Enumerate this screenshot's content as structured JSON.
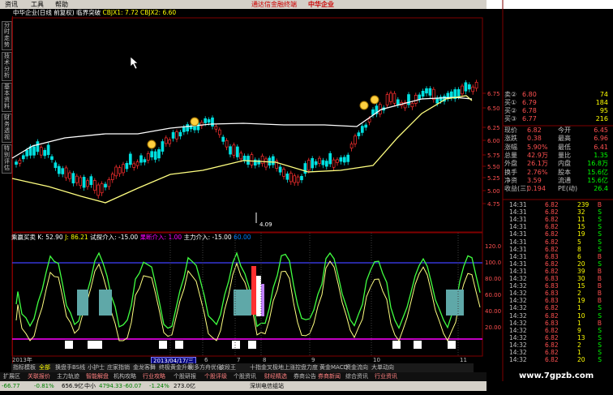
{
  "menu": {
    "items": [
      "资讯",
      "工具",
      "帮助"
    ],
    "brand": "通达信金融终端",
    "stock_name": "中华企业"
  },
  "left_tabs": [
    "分时走势",
    "技术分析",
    "基本资料",
    "财务透视",
    "特别评估"
  ],
  "chart": {
    "title_prefix": "中华企业(日线 前复权)",
    "title_indicator": "临界突破",
    "cbjx1": "CBJX1: 7.72",
    "cbjx2": "CBJX2: 6.60",
    "price_axis": [
      "6.75",
      "6.50",
      "6.25",
      "6.00",
      "5.75",
      "5.50",
      "5.25",
      "5.00",
      "4.75"
    ],
    "low_label": "4.09"
  },
  "indicator": {
    "name": "乘赢买卖",
    "k": "K: 52.90",
    "j": "J: 86.21",
    "trial": "试探介入: -15.00",
    "decisive": "果断介入: 1.00",
    "main": "主力介入: -15.00",
    "last_value": "60.00",
    "axis": [
      "120.0",
      "100.0",
      "80.00",
      "60.00",
      "40.00",
      "20.00"
    ]
  },
  "quote": [
    {
      "label": "卖②",
      "val": "6.80",
      "right": "74"
    },
    {
      "label": "买①",
      "val": "6.79",
      "right": "184"
    },
    {
      "label": "买②",
      "val": "6.78",
      "right": "95"
    },
    {
      "label": "买③",
      "val": "6.77",
      "right": "216"
    }
  ],
  "stats": [
    {
      "l1": "现价",
      "v1": "6.82",
      "l2": "今开",
      "v2": "6.45"
    },
    {
      "l1": "涨跌",
      "v1": "0.38",
      "l2": "最高",
      "v2": "6.96"
    },
    {
      "l1": "涨幅",
      "v1": "5.90%",
      "l2": "最低",
      "v2": "6.41"
    },
    {
      "l1": "总量",
      "v1": "42.9万",
      "l2": "量比",
      "v2": "1.35"
    },
    {
      "l1": "外盘",
      "v1": "26.1万",
      "l2": "内盘",
      "v2": "16.8万"
    },
    {
      "l1": "换手",
      "v1": "2.76%",
      "l2": "股本",
      "v2": "15.6亿"
    },
    {
      "l1": "净资",
      "v1": "3.59",
      "l2": "流通",
      "v2": "15.6亿"
    },
    {
      "l1": "收益(三)",
      "v1": "0.194",
      "l2": "PE(动)",
      "v2": "26.4"
    }
  ],
  "trades": [
    {
      "time": "14:31",
      "price": "6.82",
      "vol": "239",
      "bs": "B"
    },
    {
      "time": "14:31",
      "price": "6.82",
      "vol": "32",
      "bs": "S"
    },
    {
      "time": "14:31",
      "price": "6.82",
      "vol": "11",
      "bs": "S"
    },
    {
      "time": "14:31",
      "price": "6.82",
      "vol": "15",
      "bs": "S"
    },
    {
      "time": "14:31",
      "price": "6.82",
      "vol": "19",
      "bs": "S"
    },
    {
      "time": "14:31",
      "price": "6.82",
      "vol": "5",
      "bs": "S"
    },
    {
      "time": "14:31",
      "price": "6.82",
      "vol": "8",
      "bs": "S"
    },
    {
      "time": "14:31",
      "price": "6.83",
      "vol": "6",
      "bs": "B"
    },
    {
      "time": "14:31",
      "price": "6.82",
      "vol": "20",
      "bs": "S"
    },
    {
      "time": "14:31",
      "price": "6.82",
      "vol": "39",
      "bs": "B"
    },
    {
      "time": "14:32",
      "price": "6.83",
      "vol": "30",
      "bs": "B"
    },
    {
      "time": "14:32",
      "price": "6.83",
      "vol": "15",
      "bs": "B"
    },
    {
      "time": "14:32",
      "price": "6.83",
      "vol": "2",
      "bs": "B"
    },
    {
      "time": "14:32",
      "price": "6.83",
      "vol": "19",
      "bs": "B"
    },
    {
      "time": "14:32",
      "price": "6.82",
      "vol": "1",
      "bs": "S"
    },
    {
      "time": "14:32",
      "price": "6.82",
      "vol": "10",
      "bs": "S"
    },
    {
      "time": "14:32",
      "price": "6.83",
      "vol": "1",
      "bs": "B"
    },
    {
      "time": "14:32",
      "price": "6.82",
      "vol": "9",
      "bs": "S"
    },
    {
      "time": "14:32",
      "price": "6.82",
      "vol": "13",
      "bs": "S"
    },
    {
      "time": "14:32",
      "price": "6.82",
      "vol": "2",
      "bs": "S"
    },
    {
      "time": "14:32",
      "price": "6.82",
      "vol": "1",
      "bs": "S"
    },
    {
      "time": "14:32",
      "price": "6.82",
      "vol": "20",
      "bs": "S"
    }
  ],
  "axis_bottom": {
    "year": "2013年",
    "date": "2013/04/17/三",
    "months": [
      "5",
      "6",
      "7",
      "8",
      "9",
      "10",
      "11"
    ]
  },
  "tabs_row1": [
    "指标",
    "模板",
    "全部",
    "换盘手BS线",
    "小护士",
    "庄家指销",
    "金龙客舞",
    "终极黄金升级",
    "利多方舟优化",
    "波段王",
    "十指金叉",
    "极地上涨",
    "控盘力度",
    "黄金MACD",
    "资金流向",
    "大单动向"
  ],
  "tabs_row2": [
    "扩展区",
    "关联报价",
    "主力轨迹",
    "智能解盘",
    "机构攻略",
    "行业攻略",
    "个股研报",
    "个股评级",
    "个股资讯",
    "财经精选",
    "券商公告",
    "券商新闻",
    "综合资讯",
    "行业资讯"
  ],
  "status": {
    "sh": "-66.77",
    "sh_pct": "-0.81%",
    "sh_amt": "656.9亿",
    "sz_label": "中小",
    "sz": "4794.33",
    "sz_chg": "-60.07",
    "sz_pct": "-1.24%",
    "sz_amt": "273.0亿",
    "site": "深圳电信组站"
  },
  "watermark": "www.7gpzb.com",
  "colors": {
    "up": "#ff5050",
    "down": "#00ffff",
    "yellow": "#ffff00",
    "green": "#40ff40",
    "border": "#800000"
  }
}
